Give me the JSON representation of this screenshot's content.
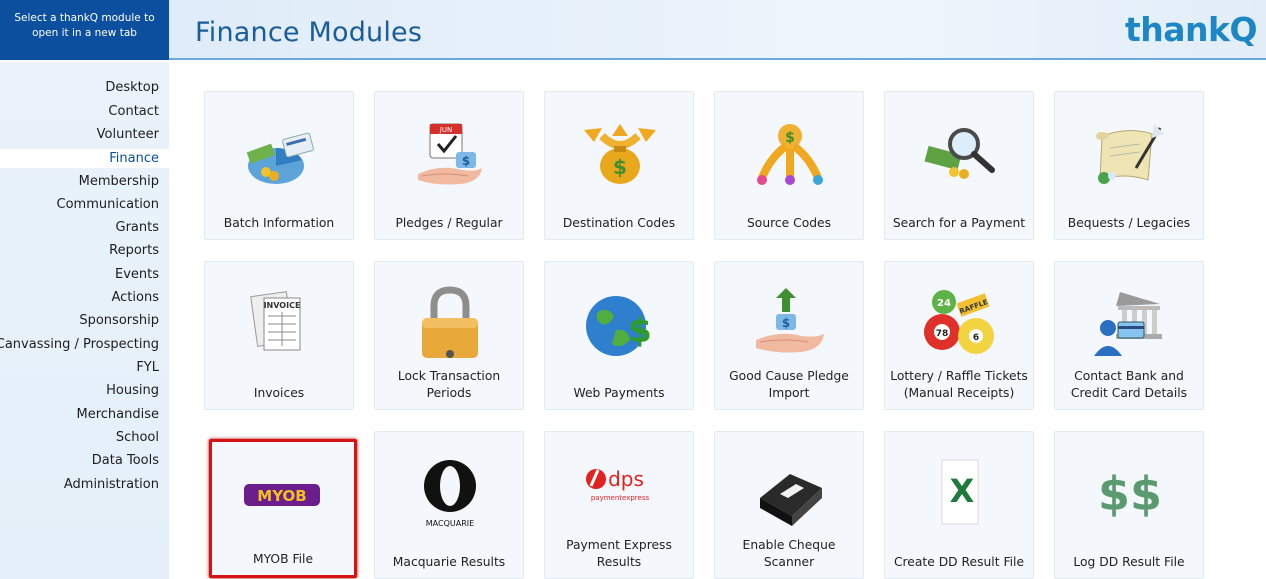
{
  "header": {
    "hint": "Select a thankQ module to open it in a new tab",
    "title": "Finance Modules",
    "logo": "thankQ"
  },
  "sidebar": {
    "items": [
      {
        "label": "Desktop"
      },
      {
        "label": "Contact"
      },
      {
        "label": "Volunteer"
      },
      {
        "label": "Finance",
        "active": true
      },
      {
        "label": "Membership"
      },
      {
        "label": "Communication"
      },
      {
        "label": "Grants"
      },
      {
        "label": "Reports"
      },
      {
        "label": "Events"
      },
      {
        "label": "Actions"
      },
      {
        "label": "Sponsorship"
      },
      {
        "label": "Canvassing / Prospecting"
      },
      {
        "label": "FYL"
      },
      {
        "label": "Housing"
      },
      {
        "label": "Merchandise"
      },
      {
        "label": "School"
      },
      {
        "label": "Data Tools"
      },
      {
        "label": "Administration"
      }
    ]
  },
  "modules": [
    {
      "label": "Batch Information",
      "icon": "batch-pie-chart-icon"
    },
    {
      "label": "Pledges / Regular",
      "icon": "calendar-hand-icon"
    },
    {
      "label": "Destination Codes",
      "icon": "money-bag-arrows-icon"
    },
    {
      "label": "Source Codes",
      "icon": "money-bag-sources-icon"
    },
    {
      "label": "Search for a Payment",
      "icon": "magnifier-money-icon"
    },
    {
      "label": "Bequests / Legacies",
      "icon": "scroll-quill-icon"
    },
    {
      "label": "Invoices",
      "icon": "invoice-icon"
    },
    {
      "label": "Lock Transaction Periods",
      "icon": "padlock-icon"
    },
    {
      "label": "Web Payments",
      "icon": "globe-dollar-icon"
    },
    {
      "label": "Good Cause Pledge Import",
      "icon": "hand-dollar-upload-icon"
    },
    {
      "label": "Lottery / Raffle Tickets (Manual Receipts)",
      "icon": "lottery-balls-icon"
    },
    {
      "label": "Contact Bank and Credit Card Details",
      "icon": "bank-card-icon"
    },
    {
      "label": "MYOB File",
      "icon": "myob-logo-icon",
      "logo_text": "MYOB",
      "selected": true
    },
    {
      "label": "Macquarie Results",
      "icon": "macquarie-logo-icon",
      "logo_text": "MACQUARIE"
    },
    {
      "label": "Payment Express Results",
      "icon": "dps-logo-icon",
      "logo_text": "dps",
      "logo_subtext": "paymentexpress"
    },
    {
      "label": "Enable Cheque Scanner",
      "icon": "cheque-scanner-icon"
    },
    {
      "label": "Create DD Result File",
      "icon": "excel-file-icon",
      "logo_text": "X"
    },
    {
      "label": "Log DD Result File",
      "icon": "dollar-signs-icon",
      "logo_text": "$$"
    }
  ],
  "colors": {
    "brand": "#0b4f9e",
    "title": "#1b5c99",
    "logo": "#1c87c4",
    "selection": "#d41414"
  }
}
